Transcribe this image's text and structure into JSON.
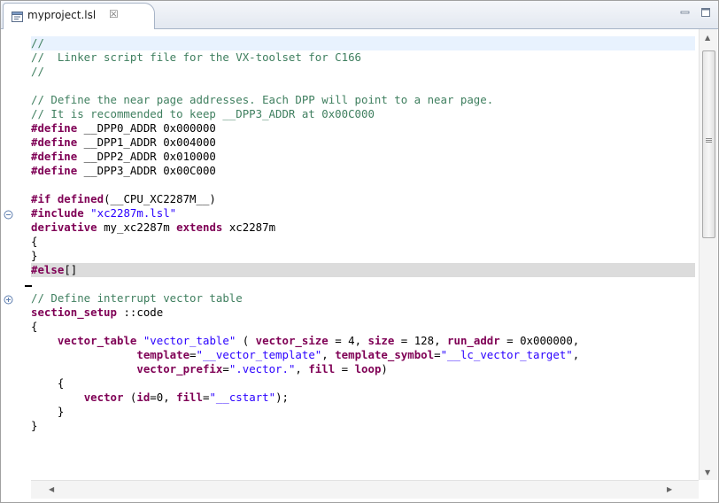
{
  "tab": {
    "title": "myproject.lsl",
    "close_glyph": "☒",
    "icon": "linker-script-file-icon"
  },
  "window_controls": {
    "minimize": "minimize-icon",
    "maximize": "maximize-icon"
  },
  "colors": {
    "comment": "#3f7f5f",
    "keyword": "#7f0055",
    "string": "#2a00ff",
    "current_line": "#e8f2fe",
    "folded_line": "#dcdcdc"
  },
  "code_lines": [
    {
      "segs": [
        {
          "c": "cm",
          "t": "//"
        }
      ]
    },
    {
      "segs": [
        {
          "c": "cm",
          "t": "//  Linker script file for the VX-toolset for C166"
        }
      ]
    },
    {
      "segs": [
        {
          "c": "cm",
          "t": "//"
        }
      ]
    },
    {
      "segs": []
    },
    {
      "segs": [
        {
          "c": "cm",
          "t": "// Define the near page addresses. Each DPP will point to a near page."
        }
      ]
    },
    {
      "segs": [
        {
          "c": "cm",
          "t": "// It is recommended to keep __DPP3_ADDR at 0x00C000"
        }
      ]
    },
    {
      "segs": [
        {
          "c": "kw",
          "t": "#define"
        },
        {
          "c": "pl",
          "t": " __DPP0_ADDR 0x000000"
        }
      ]
    },
    {
      "segs": [
        {
          "c": "kw",
          "t": "#define"
        },
        {
          "c": "pl",
          "t": " __DPP1_ADDR 0x004000"
        }
      ]
    },
    {
      "segs": [
        {
          "c": "kw",
          "t": "#define"
        },
        {
          "c": "pl",
          "t": " __DPP2_ADDR 0x010000"
        }
      ]
    },
    {
      "segs": [
        {
          "c": "kw",
          "t": "#define"
        },
        {
          "c": "pl",
          "t": " __DPP3_ADDR 0x00C000"
        }
      ]
    },
    {
      "segs": []
    },
    {
      "segs": [
        {
          "c": "kw",
          "t": "#if defined"
        },
        {
          "c": "pl",
          "t": "(__CPU_XC2287M__)"
        }
      ]
    },
    {
      "segs": [
        {
          "c": "kw",
          "t": "#include"
        },
        {
          "c": "pl",
          "t": " "
        },
        {
          "c": "st",
          "t": "\"xc2287m.lsl\""
        }
      ]
    },
    {
      "segs": [
        {
          "c": "kw",
          "t": "derivative"
        },
        {
          "c": "pl",
          "t": " my_xc2287m "
        },
        {
          "c": "kw",
          "t": "extends"
        },
        {
          "c": "pl",
          "t": " xc2287m"
        }
      ]
    },
    {
      "segs": [
        {
          "c": "pl",
          "t": "{"
        }
      ]
    },
    {
      "segs": [
        {
          "c": "pl",
          "t": "}"
        }
      ]
    },
    {
      "segs": [
        {
          "c": "kw",
          "t": "#else"
        },
        {
          "c": "pl",
          "t": "[]"
        }
      ]
    },
    {
      "segs": []
    },
    {
      "segs": [
        {
          "c": "cm",
          "t": "// Define interrupt vector table"
        }
      ]
    },
    {
      "segs": [
        {
          "c": "kw",
          "t": "section_setup"
        },
        {
          "c": "pl",
          "t": " ::code"
        }
      ]
    },
    {
      "segs": [
        {
          "c": "pl",
          "t": "{"
        }
      ]
    },
    {
      "segs": [
        {
          "c": "pl",
          "t": "    "
        },
        {
          "c": "kw",
          "t": "vector_table"
        },
        {
          "c": "pl",
          "t": " "
        },
        {
          "c": "st",
          "t": "\"vector_table\""
        },
        {
          "c": "pl",
          "t": " ( "
        },
        {
          "c": "kw",
          "t": "vector_size"
        },
        {
          "c": "pl",
          "t": " = 4, "
        },
        {
          "c": "kw",
          "t": "size"
        },
        {
          "c": "pl",
          "t": " = 128, "
        },
        {
          "c": "kw",
          "t": "run_addr"
        },
        {
          "c": "pl",
          "t": " = 0x000000,"
        }
      ]
    },
    {
      "segs": [
        {
          "c": "pl",
          "t": "                "
        },
        {
          "c": "kw",
          "t": "template"
        },
        {
          "c": "pl",
          "t": "="
        },
        {
          "c": "st",
          "t": "\"__vector_template\""
        },
        {
          "c": "pl",
          "t": ", "
        },
        {
          "c": "kw",
          "t": "template_symbol"
        },
        {
          "c": "pl",
          "t": "="
        },
        {
          "c": "st",
          "t": "\"__lc_vector_target\""
        },
        {
          "c": "pl",
          "t": ","
        }
      ]
    },
    {
      "segs": [
        {
          "c": "pl",
          "t": "                "
        },
        {
          "c": "kw",
          "t": "vector_prefix"
        },
        {
          "c": "pl",
          "t": "="
        },
        {
          "c": "st",
          "t": "\".vector.\""
        },
        {
          "c": "pl",
          "t": ", "
        },
        {
          "c": "kw",
          "t": "fill"
        },
        {
          "c": "pl",
          "t": " = "
        },
        {
          "c": "kw",
          "t": "loop"
        },
        {
          "c": "pl",
          "t": ")"
        }
      ]
    },
    {
      "segs": [
        {
          "c": "pl",
          "t": "    {"
        }
      ]
    },
    {
      "segs": [
        {
          "c": "pl",
          "t": "        "
        },
        {
          "c": "kw",
          "t": "vector"
        },
        {
          "c": "pl",
          "t": " ("
        },
        {
          "c": "kw",
          "t": "id"
        },
        {
          "c": "pl",
          "t": "=0, "
        },
        {
          "c": "kw",
          "t": "fill"
        },
        {
          "c": "pl",
          "t": "="
        },
        {
          "c": "st",
          "t": "\"__cstart\""
        },
        {
          "c": "pl",
          "t": ");"
        }
      ]
    },
    {
      "segs": [
        {
          "c": "pl",
          "t": "    }"
        }
      ]
    },
    {
      "segs": [
        {
          "c": "pl",
          "t": "}"
        }
      ]
    }
  ]
}
